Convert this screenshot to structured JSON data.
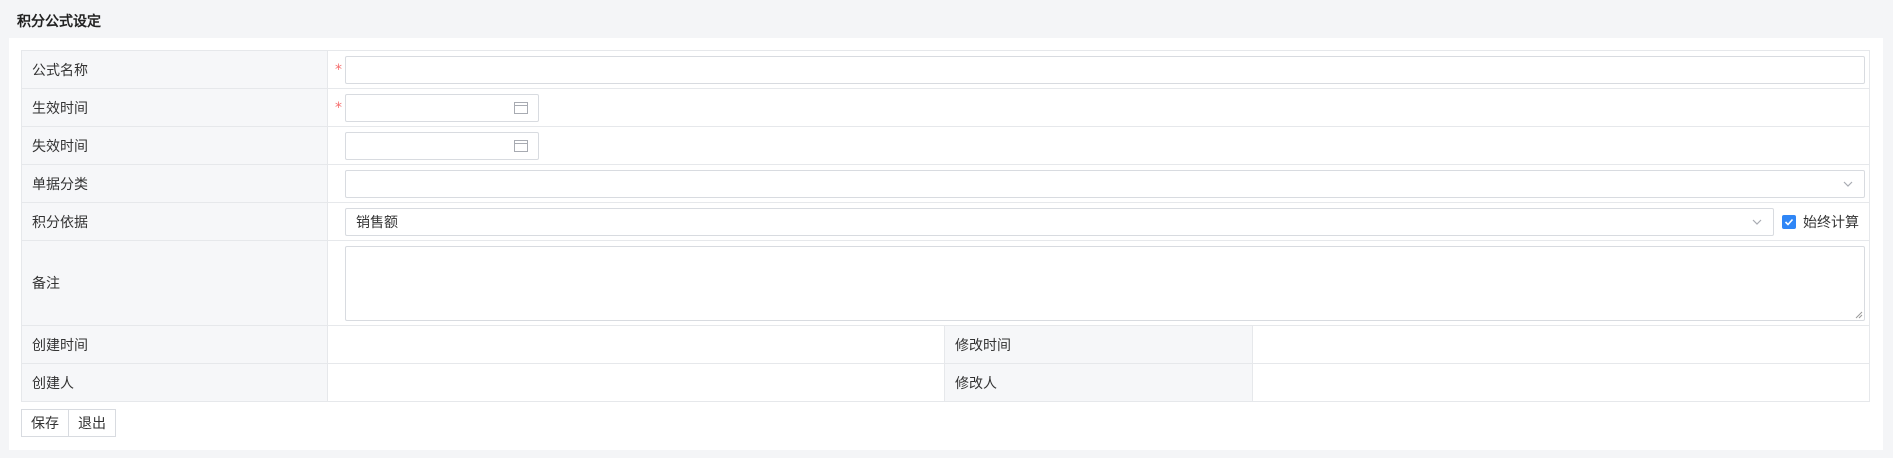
{
  "page": {
    "title": "积分公式设定"
  },
  "form": {
    "formula_name": {
      "label": "公式名称",
      "value": "",
      "required": true
    },
    "effective_time": {
      "label": "生效时间",
      "value": "",
      "required": true
    },
    "expiry_time": {
      "label": "失效时间",
      "value": ""
    },
    "document_category": {
      "label": "单据分类",
      "value": ""
    },
    "points_basis": {
      "label": "积分依据",
      "value": "销售额",
      "checkbox_label": "始终计算",
      "checkbox_checked": true
    },
    "remark": {
      "label": "备注",
      "value": ""
    },
    "created_time": {
      "label": "创建时间",
      "value": ""
    },
    "modified_time": {
      "label": "修改时间",
      "value": ""
    },
    "creator": {
      "label": "创建人",
      "value": ""
    },
    "modifier": {
      "label": "修改人",
      "value": ""
    },
    "required_mark": "*"
  },
  "buttons": {
    "save": "保存",
    "exit": "退出"
  },
  "colors": {
    "required": "#f56c6c",
    "checkbox": "#2f86f6",
    "label_bg": "#f6f7f9",
    "border": "#e6e8eb"
  },
  "icons": {
    "date": "calendar-icon",
    "select": "chevron-down-icon",
    "check": "check-icon"
  }
}
